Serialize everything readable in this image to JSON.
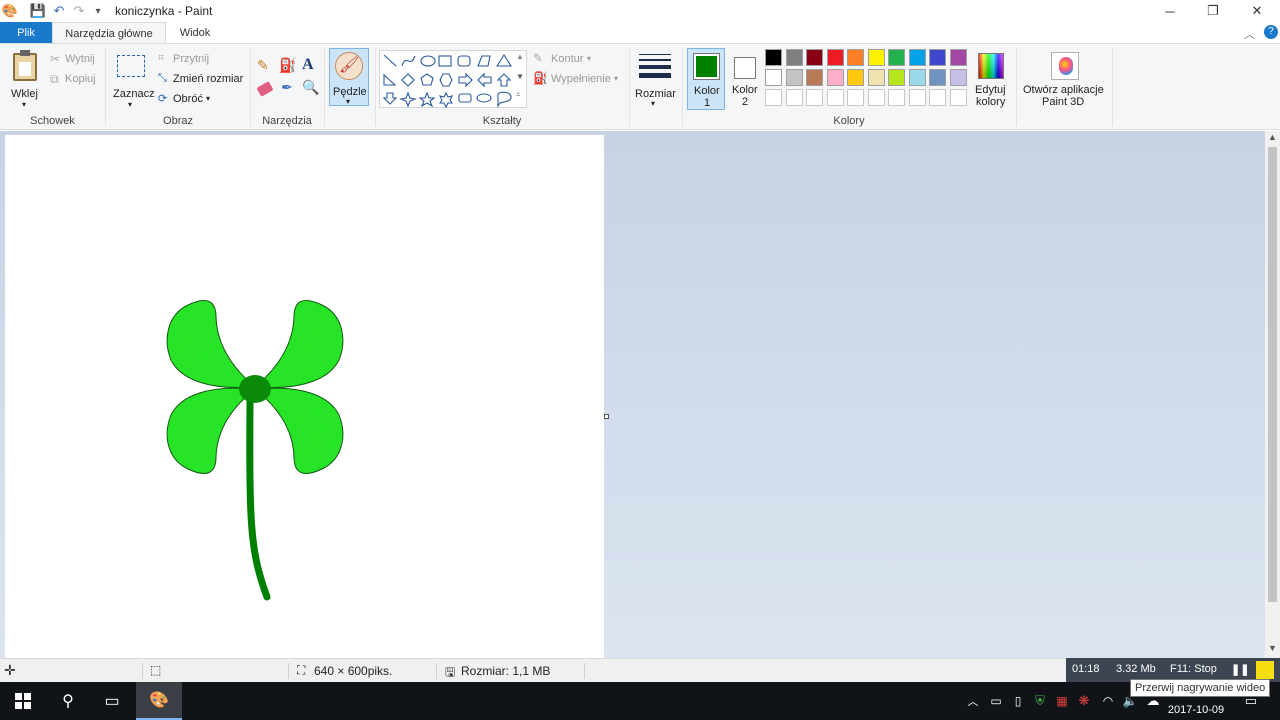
{
  "window": {
    "title": "koniczynka - Paint",
    "buttons": [
      "─",
      "❐",
      "✕"
    ]
  },
  "tabs": {
    "file": "Plik",
    "home": "Narzędzia główne",
    "view": "Widok"
  },
  "ribbon": {
    "clipboard": {
      "paste": "Wklej",
      "cut": "Wytnij",
      "copy": "Kopiuj",
      "group": "Schowek"
    },
    "image": {
      "select": "Zaznacz",
      "crop": "Przytnij",
      "resize": "Zmień rozmiar",
      "rotate": "Obróć",
      "group": "Obraz"
    },
    "tools": {
      "group": "Narzędzia"
    },
    "brushes": {
      "label": "Pędzle"
    },
    "shapes": {
      "outline": "Kontur",
      "fill": "Wypełnienie",
      "group": "Kształty"
    },
    "size": {
      "label": "Rozmiar"
    },
    "colors": {
      "color1_line1": "Kolor",
      "color1_line2": "1",
      "color2_line1": "Kolor",
      "color2_line2": "2",
      "edit_line1": "Edytuj",
      "edit_line2": "kolory",
      "group": "Kolory",
      "color1_value": "#008000",
      "color2_value": "#ffffff",
      "palette_row1": [
        "#000000",
        "#7f7f7f",
        "#880015",
        "#ed1c24",
        "#ff7f27",
        "#fff200",
        "#22b14c",
        "#00a2e8",
        "#3f48cc",
        "#a349a4"
      ],
      "palette_row2": [
        "#ffffff",
        "#c3c3c3",
        "#b97a57",
        "#ffaec9",
        "#ffc90e",
        "#efe4b0",
        "#b5e61d",
        "#99d9ea",
        "#7092be",
        "#c8bfe7"
      ],
      "palette_row3": [
        "#ffffff",
        "#ffffff",
        "#ffffff",
        "#ffffff",
        "#ffffff",
        "#ffffff",
        "#ffffff",
        "#ffffff",
        "#ffffff",
        "#ffffff"
      ]
    },
    "paint3d": {
      "line1": "Otwórz aplikacje",
      "line2": "Paint 3D"
    }
  },
  "statusbar": {
    "dimensions": "640 × 600piks.",
    "size": "Rozmiar: 1,1 MB"
  },
  "recorder": {
    "time": "01:18",
    "filesize": "3.32 Mb",
    "stop": "F11: Stop",
    "tooltip": "Przerwij nagrywanie wideo"
  },
  "taskbar": {
    "date": "2017-10-09"
  },
  "clover": {
    "leaf_color": "#22ee22",
    "dark_color": "#0b8a0b",
    "stem_color": "#008000"
  }
}
